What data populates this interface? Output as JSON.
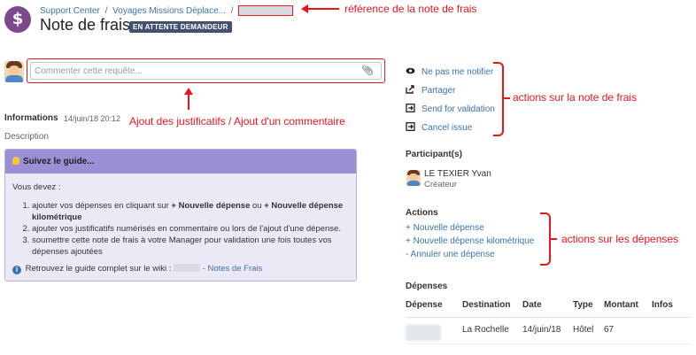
{
  "header": {
    "breadcrumbs": [
      "Support Center",
      "/",
      "Voyages Missions Déplace...",
      "/"
    ],
    "title": "Note de frais",
    "status_badge": "EN ATTENTE DEMANDEUR"
  },
  "annotations": {
    "reference": "référence de la note de frais",
    "justificatifs": "Ajout des justificatifs / Ajout d'un commentaire",
    "actions_note": "actions sur la note de frais",
    "actions_depenses": "actions sur les dépenses"
  },
  "comment": {
    "placeholder": "Commenter cette requête..."
  },
  "informations": {
    "heading": "Informations",
    "date": "14/juin/18 20:12",
    "description_label": "Description"
  },
  "guide": {
    "title": "Suivez le guide...",
    "intro": "Vous devez :",
    "steps": [
      {
        "pre": "ajouter vos dépenses en cliquant sur ",
        "b1": "+ Nouvelle dépense",
        "mid": " ou ",
        "b2": "+ Nouvelle dépense kilométrique"
      },
      {
        "text": "ajouter vos justificatifs numérisés en commentaire ou lors de l'ajout d'une dépense."
      },
      {
        "text": "soumettre cette note de frais à votre Manager pour validation une fois toutes vos dépenses ajoutées"
      }
    ],
    "wiki_text": "Retrouvez le guide complet sur le wiki :",
    "wiki_link": "- Notes de Frais"
  },
  "request_actions": [
    {
      "label": "Ne pas me notifier",
      "icon": "eye-icon"
    },
    {
      "label": "Partager",
      "icon": "share-icon"
    },
    {
      "label": "Send for validation",
      "icon": "transition-icon"
    },
    {
      "label": "Cancel issue",
      "icon": "transition-icon"
    }
  ],
  "participants": {
    "heading": "Participant(s)",
    "name": "LE TEXIER Yvan",
    "role": "Créateur"
  },
  "actions": {
    "heading": "Actions",
    "items": [
      "+ Nouvelle dépense",
      "+ Nouvelle dépense kilométrique",
      "- Annuler une dépense"
    ]
  },
  "depenses": {
    "heading": "Dépenses",
    "columns": [
      "Dépense",
      "Destination",
      "Date",
      "Type",
      "Montant",
      "Infos"
    ],
    "rows": [
      {
        "destination": "La Rochelle",
        "date": "14/juin/18",
        "type": "Hôtel",
        "montant": "67",
        "infos": ""
      }
    ]
  },
  "colors": {
    "accent": "#3b73af",
    "annotation": "#e8151b",
    "badge": "#42526e",
    "guide_header": "#9c8fd6"
  }
}
